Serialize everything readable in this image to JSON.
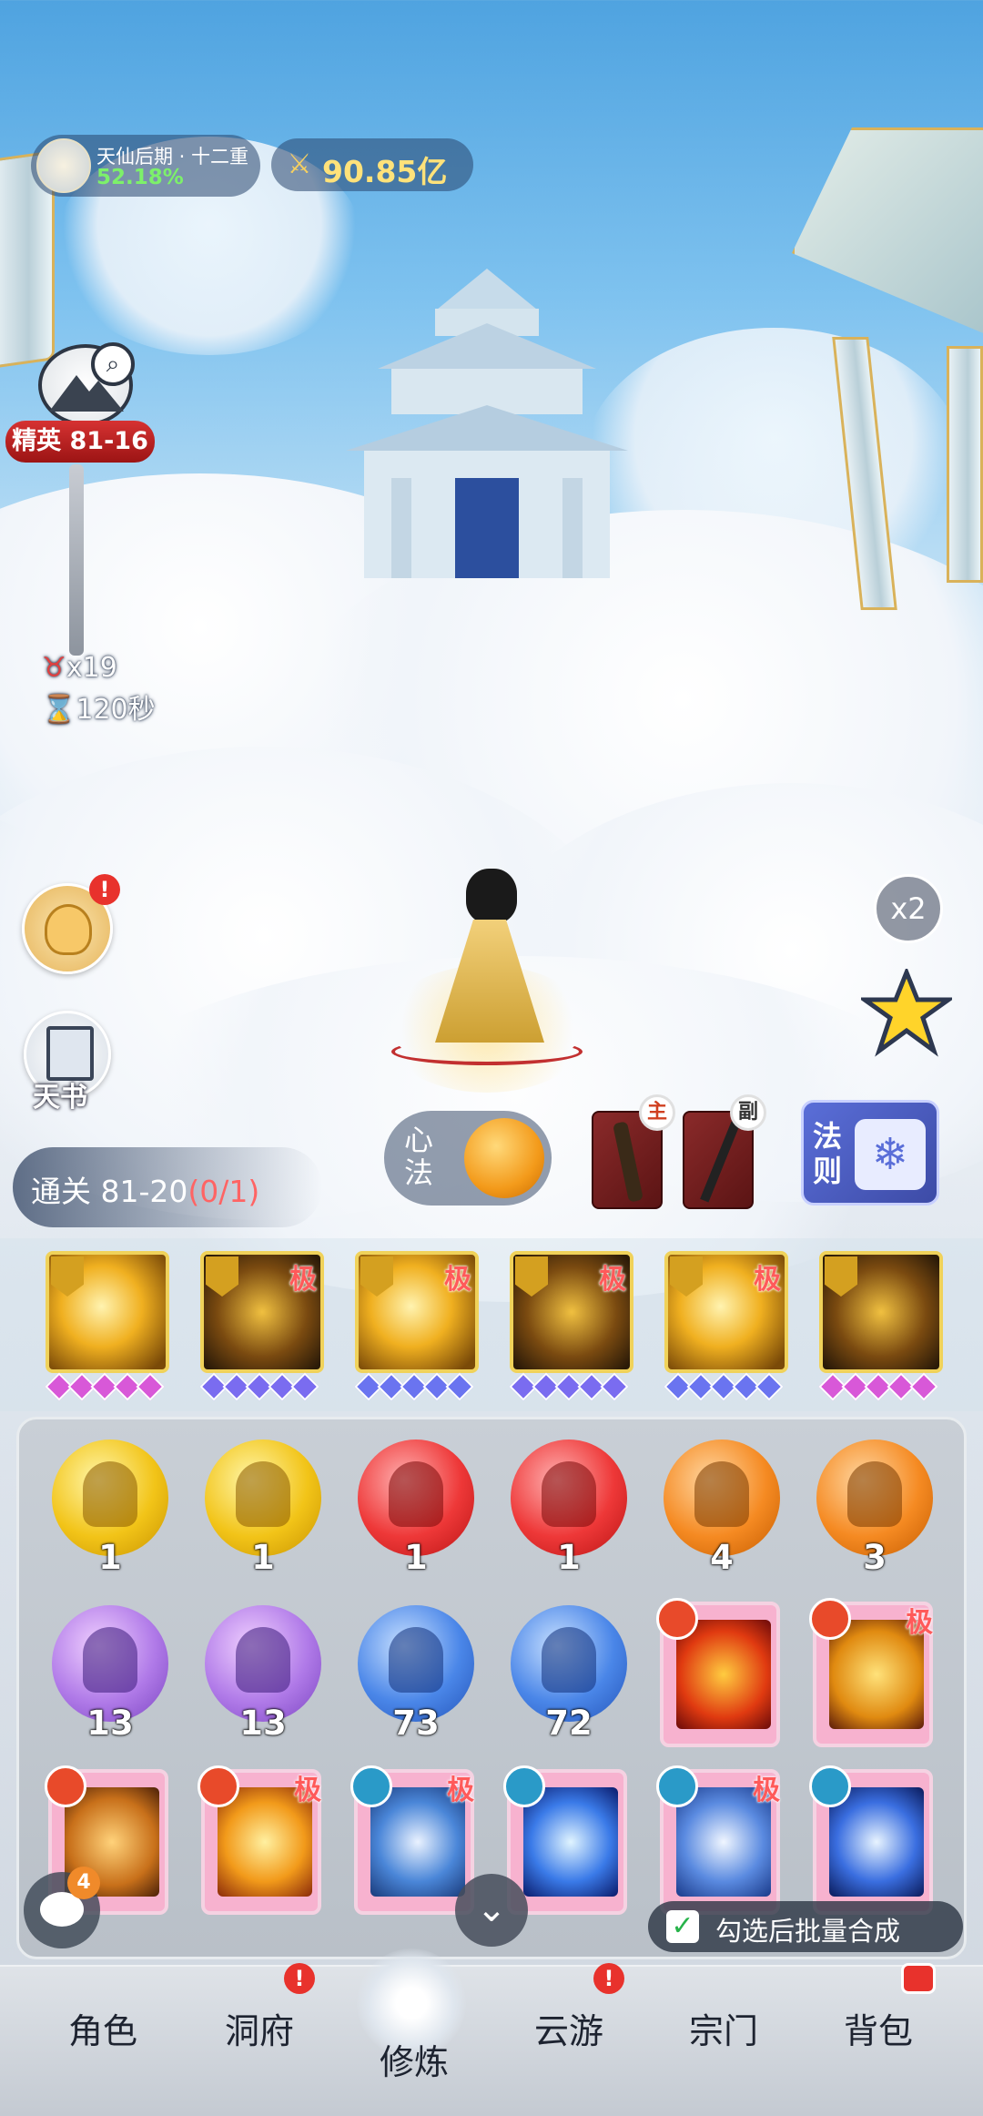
{
  "hud": {
    "realm_title": "天仙后期 · 十二重",
    "realm_progress": "52.18%",
    "combat_power": "90.85亿"
  },
  "stage": {
    "badge": "精英 81-16",
    "kill_count": "x19",
    "time_left": "120秒"
  },
  "side": {
    "gift_alert": "!",
    "tianshu_label": "天书",
    "speed_label": "x2"
  },
  "clear": {
    "text": "通关 81-20",
    "progress": "(0/1)"
  },
  "equip": {
    "xinfa_label": "心法",
    "main_tag": "主",
    "sub_tag": "副",
    "law_label": "法则"
  },
  "skills": [
    {
      "tier": "",
      "gem_color": "#d858d8"
    },
    {
      "tier": "极",
      "gem_color": "#7a6cf0"
    },
    {
      "tier": "极",
      "gem_color": "#6a74f0"
    },
    {
      "tier": "极",
      "gem_color": "#7a6cf0"
    },
    {
      "tier": "极",
      "gem_color": "#6a74f0"
    },
    {
      "tier": "",
      "gem_color": "#d858d8"
    }
  ],
  "orbs_row1": [
    {
      "count": "1",
      "color": "yellow"
    },
    {
      "count": "1",
      "color": "yellow"
    },
    {
      "count": "1",
      "color": "red"
    },
    {
      "count": "1",
      "color": "red"
    },
    {
      "count": "4",
      "color": "orange"
    },
    {
      "count": "3",
      "color": "orange"
    }
  ],
  "orbs_row2": [
    {
      "count": "13",
      "color": "purple"
    },
    {
      "count": "13",
      "color": "purple"
    },
    {
      "count": "73",
      "color": "blue"
    },
    {
      "count": "72",
      "color": "blue"
    }
  ],
  "cards_row2": [
    {
      "tier": "",
      "art": "phoenix"
    },
    {
      "tier": "极",
      "art": "pagoda"
    }
  ],
  "cards_row3": [
    {
      "tier": "",
      "art": "fire-swirl"
    },
    {
      "tier": "极",
      "art": "lotus"
    },
    {
      "tier": "极",
      "art": "pot"
    },
    {
      "tier": "",
      "art": "lightning"
    },
    {
      "tier": "极",
      "art": "taiji"
    },
    {
      "tier": "",
      "art": "crossed-swords"
    }
  ],
  "chat": {
    "badge": "4"
  },
  "batch": {
    "label": "勾选后批量合成"
  },
  "nav": {
    "tabs": [
      "角色",
      "洞府",
      "修炼",
      "云游",
      "宗门",
      "背包"
    ],
    "badge": "!"
  }
}
